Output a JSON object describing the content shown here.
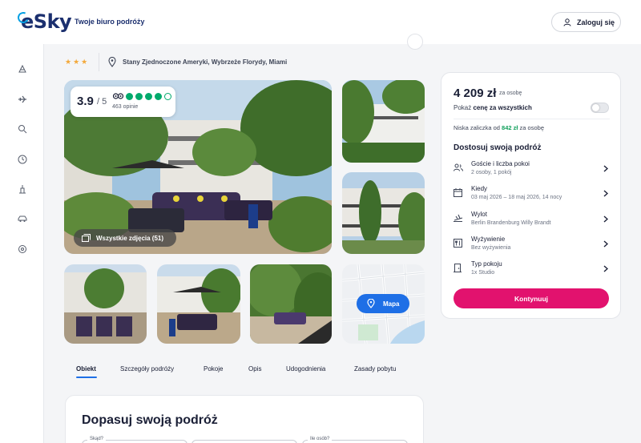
{
  "header": {
    "logo_text": "eSky",
    "tagline": "Twoje biuro podróży",
    "login_label": "Zaloguj się"
  },
  "hotel": {
    "stars": "★★★",
    "location": "Stany Zjednoczone Ameryki, Wybrzeże Florydy, Miami"
  },
  "rating": {
    "score": "3.9",
    "out_of": "/ 5",
    "reviews": "463 opinie",
    "bubbles_filled": 4,
    "bubbles_total": 5
  },
  "gallery": {
    "all_photos_label": "Wszystkie zdjęcia (51)",
    "map_label": "Mapa"
  },
  "tabs": [
    {
      "label": "Obiekt",
      "active": true
    },
    {
      "label": "Szczegóły podróży",
      "active": false
    },
    {
      "label": "Pokoje",
      "active": false
    },
    {
      "label": "Opis",
      "active": false
    },
    {
      "label": "Udogodnienia",
      "active": false
    },
    {
      "label": "Zasady pobytu",
      "active": false
    }
  ],
  "adjust": {
    "title": "Dopasuj swoją podróż",
    "from_label": "Skąd?",
    "guests_label": "Ile osób?"
  },
  "price_card": {
    "price": "4 209 zł",
    "per_person": "za osobę",
    "show_total_prefix": "Pokaż ",
    "show_total_bold": "cenę za wszystkich",
    "deposit_prefix": "Niska zaliczka od ",
    "deposit_amount": "842 zł",
    "deposit_suffix": " za osobę",
    "customize_title": "Dostosuj swoją podróż",
    "options": [
      {
        "title": "Goście i liczba pokoi",
        "sub": "2 osoby, 1 pokój"
      },
      {
        "title": "Kiedy",
        "sub": "03 maj 2026 – 18 maj 2026, 14 nocy"
      },
      {
        "title": "Wylot",
        "sub": "Berlin Brandenburg Willy Brandt"
      },
      {
        "title": "Wyżywienie",
        "sub": "Bez wyżywienia"
      },
      {
        "title": "Typ pokoju",
        "sub": "1x Studio"
      }
    ],
    "continue_label": "Kontynuuj"
  },
  "colors": {
    "brand_pink": "#e2126e",
    "accent_blue": "#1e6fe6",
    "rating_green": "#00aa6c",
    "star_orange": "#f3a93b"
  }
}
